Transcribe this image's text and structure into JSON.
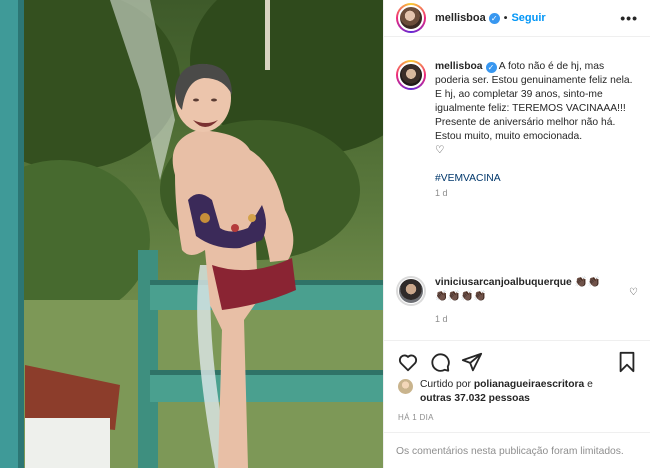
{
  "post": {
    "username": "mellisboa",
    "follow_label": "Seguir",
    "dot": "•",
    "more": "•••",
    "caption_lines": [
      "A foto não é de hj, mas poderia ser. Estou genuinamente feliz nela.",
      "E hj, ao completar 39 anos, sinto-me igualmente feliz: TEREMOS VACINAAA!!!",
      "Presente de aniversário melhor não há.",
      "Estou muito, muito emocionada.",
      "♡"
    ],
    "hashtag": "#VEMVACINA",
    "caption_time": "1 d"
  },
  "comment": {
    "username": "viniciusarcanjoalbuquerque",
    "text": "👏🏿👏🏿 👏🏿👏🏿👏🏿👏🏿",
    "time": "1 d",
    "like_icon": "♡"
  },
  "likes": {
    "prefix": "Curtido por ",
    "user": "polianagueiraescritora",
    "middle": " e",
    "others": "outras 37.032 pessoas"
  },
  "posted_ago": "HÁ 1 DIA",
  "comments_limited": "Os comentários nesta publicação foram limitados.",
  "icons": [
    "heart-icon",
    "comment-icon",
    "share-icon",
    "bookmark-icon",
    "more-icon",
    "verified-icon"
  ],
  "colors": {
    "link": "#0095f6",
    "hashtag": "#00376b",
    "muted": "#8e8e8e",
    "verified": "#3897f0"
  }
}
